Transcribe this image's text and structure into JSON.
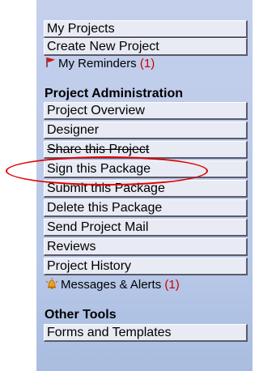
{
  "nav": {
    "my_projects": "My Projects",
    "create_new_project": "Create New Project",
    "my_reminders_label": "My Reminders",
    "my_reminders_count": "(1)"
  },
  "project_admin": {
    "heading": "Project Administration",
    "items": [
      "Project Overview",
      "Designer",
      "Share this Project",
      "Sign this Package",
      "Submit this Package",
      "Delete this Package",
      "Send Project Mail",
      "Reviews",
      "Project History"
    ],
    "messages_label": "Messages & Alerts",
    "messages_count": "(1)"
  },
  "other_tools": {
    "heading": "Other Tools",
    "items": [
      "Forms and Templates"
    ]
  },
  "icons": {
    "reminders": "red-flag-icon",
    "messages": "alert-bell-icon"
  },
  "colors": {
    "panel": "#c4d0ec",
    "button": "#e8ebf4",
    "count": "#cc0000",
    "annotation": "#e00000"
  }
}
